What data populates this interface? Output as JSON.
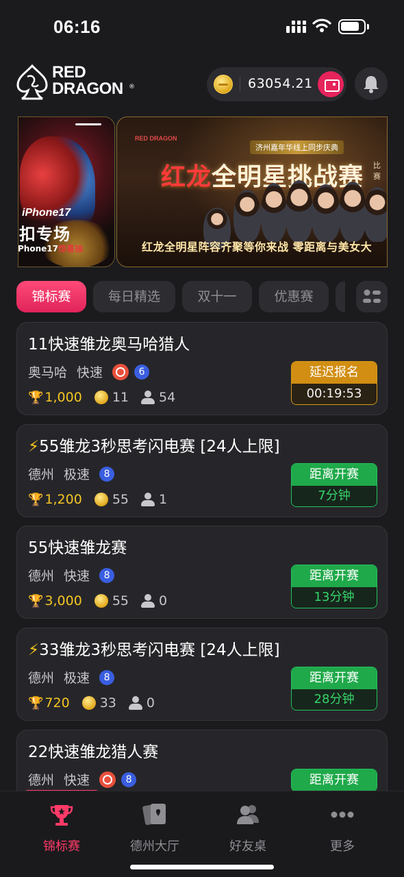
{
  "status_bar": {
    "time": "06:16"
  },
  "header": {
    "logo_line1": "RED",
    "logo_line2": "DRAGON",
    "logo_reg": "®",
    "balance": "63054.21",
    "icons": [
      "coin-icon",
      "wallet-icon",
      "bell-icon"
    ]
  },
  "banners": {
    "left": {
      "line1": "iPhone17",
      "line2": "扣专场",
      "line3_prefix": "Phone17",
      "line3_highlight": "惊喜抽"
    },
    "main": {
      "logo": "RED DRAGON",
      "tag": "济州嘉年华线上同步庆典",
      "title_red": "红龙",
      "title_rest": "全明星挑战赛",
      "side1": "比赛",
      "side2": "报",
      "bottom": "红龙全明星阵容齐聚等你来战  零距离与美女大"
    }
  },
  "tabs": [
    {
      "label": "锦标赛",
      "active": true
    },
    {
      "label": "每日精选",
      "active": false
    },
    {
      "label": "双十一",
      "active": false
    },
    {
      "label": "优惠赛",
      "active": false
    }
  ],
  "tournaments": [
    {
      "title": "11快速雏龙奥马哈猎人",
      "bolt": "",
      "game": "奥马哈",
      "speed": "快速",
      "bounty": true,
      "seats": "6",
      "prize": "1,000",
      "fee": "11",
      "players": "54",
      "status_top": "延迟报名",
      "status_bottom": "00:19:53",
      "status_color": "orange"
    },
    {
      "title": "55雏龙3秒思考闪电赛 [24人上限]",
      "bolt": "⚡",
      "game": "德州",
      "speed": "极速",
      "bounty": false,
      "seats": "8",
      "prize": "1,200",
      "fee": "55",
      "players": "1",
      "status_top": "距离开赛",
      "status_bottom": "7分钟",
      "status_color": "green"
    },
    {
      "title": "55快速雏龙赛",
      "bolt": "",
      "game": "德州",
      "speed": "快速",
      "bounty": false,
      "seats": "8",
      "prize": "3,000",
      "fee": "55",
      "players": "0",
      "status_top": "距离开赛",
      "status_bottom": "13分钟",
      "status_color": "green"
    },
    {
      "title": "33雏龙3秒思考闪电赛 [24人上限]",
      "bolt": "⚡",
      "game": "德州",
      "speed": "极速",
      "bounty": false,
      "seats": "8",
      "prize": "720",
      "fee": "33",
      "players": "0",
      "status_top": "距离开赛",
      "status_bottom": "28分钟",
      "status_color": "green"
    },
    {
      "title": "22快速雏龙猎人赛",
      "bolt": "",
      "game": "德州",
      "speed": "快速",
      "bounty": true,
      "seats": "8",
      "prize": "",
      "fee": "",
      "players": "",
      "status_top": "距离开赛",
      "status_bottom": "",
      "status_color": "green"
    }
  ],
  "bottom_nav": [
    {
      "label": "锦标赛",
      "icon": "trophy-icon",
      "active": true
    },
    {
      "label": "德州大厅",
      "icon": "cards-icon",
      "active": false
    },
    {
      "label": "好友桌",
      "icon": "friends-icon",
      "active": false
    },
    {
      "label": "更多",
      "icon": "more-icon",
      "active": false
    }
  ],
  "colors": {
    "accent": "#e6245c",
    "green": "#1fa94a",
    "orange": "#d18e12",
    "gold": "#f5c623"
  }
}
